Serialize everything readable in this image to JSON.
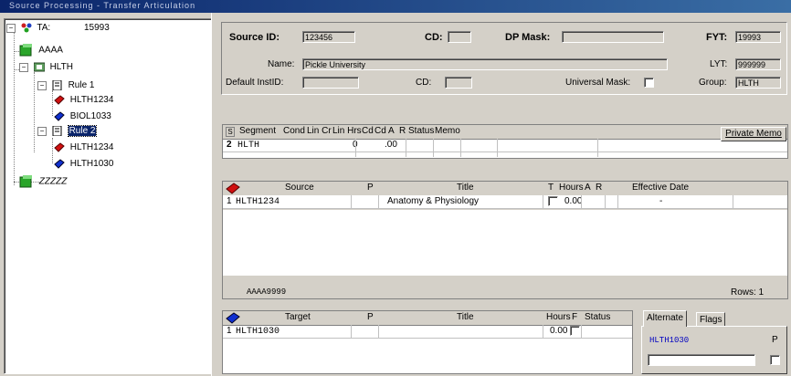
{
  "window": {
    "title": "Source Processing - Transfer Articulation"
  },
  "tree": {
    "root_label": "TA:",
    "root_number": "15993",
    "nodes": [
      {
        "label": "AAAA"
      },
      {
        "label": "HLTH"
      },
      {
        "label": "Rule 1"
      },
      {
        "label": "HLTH1234"
      },
      {
        "label": "BIOL1033"
      },
      {
        "label": "Rule 2"
      },
      {
        "label": "HLTH1234"
      },
      {
        "label": "HLTH1030"
      },
      {
        "label": "ZZZZZ"
      }
    ]
  },
  "header": {
    "source_id_label": "Source ID:",
    "source_id_value": "123456",
    "cd_label": "CD:",
    "cd_value": "",
    "dp_mask_label": "DP Mask:",
    "dp_mask_value": "",
    "fyt_label": "FYT:",
    "fyt_value": "19993",
    "name_label": "Name:",
    "name_value": "Pickle University",
    "lyt_label": "LYT:",
    "lyt_value": "999999",
    "default_instid_label": "Default InstID:",
    "default_instid_value": "",
    "cd2_label": "CD:",
    "cd2_value": "",
    "universal_mask_label": "Universal Mask:",
    "group_label": "Group:",
    "group_value": "HLTH"
  },
  "segment": {
    "columns": [
      "S",
      "Segment",
      "Cond",
      "Lin Cr",
      "Lin Hrs",
      "Cd",
      "Cd",
      "A",
      "R",
      "Status",
      "Memo"
    ],
    "row": {
      "num": "2",
      "segment": "HLTH",
      "lin_cr": "0",
      "lin_hrs": ".00"
    },
    "private_memo_label": "Private Memo"
  },
  "source_grid": {
    "columns": [
      "Source",
      "P",
      "Title",
      "T",
      "Hours",
      "A",
      "R",
      "Effective Date"
    ],
    "row": {
      "num": "1",
      "source": "HLTH1234",
      "title": "Anatomy & Physiology",
      "hours": "0.00",
      "eff_date": "-"
    },
    "footer_left": "AAAA9999",
    "rows_label": "Rows: 1"
  },
  "target_grid": {
    "columns": [
      "Target",
      "P",
      "Title",
      "Hours",
      "F",
      "Status"
    ],
    "row": {
      "num": "1",
      "target": "HLTH1030",
      "hours": "0.00"
    }
  },
  "tabs": {
    "alternate": "Alternate",
    "flags": "Flags",
    "alt_value": "HLTH1030",
    "p_label": "P"
  },
  "colors": {
    "selection": "#0a246a",
    "link_blue": "#0000c0",
    "titlebar": "#0a246a"
  }
}
